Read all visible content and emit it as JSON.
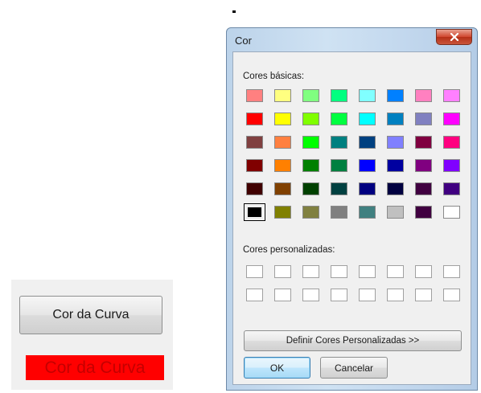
{
  "app": {
    "button_label": "Cor da Curva",
    "label_text": "Cor da Curva",
    "label_color": "#ff0000"
  },
  "dialog": {
    "title": "Cor",
    "close_icon": "close-icon",
    "basic_colors_label": "Cores básicas:",
    "basic_colors": [
      "#ff8080",
      "#ffff80",
      "#80ff80",
      "#00ff80",
      "#80ffff",
      "#0080ff",
      "#ff80c0",
      "#ff80ff",
      "#ff0000",
      "#ffff00",
      "#80ff00",
      "#00ff40",
      "#00ffff",
      "#0080c0",
      "#8080c0",
      "#ff00ff",
      "#804040",
      "#ff8040",
      "#00ff00",
      "#008080",
      "#004080",
      "#8080ff",
      "#800040",
      "#ff0080",
      "#800000",
      "#ff8000",
      "#008000",
      "#008040",
      "#0000ff",
      "#0000a0",
      "#800080",
      "#8000ff",
      "#400000",
      "#804000",
      "#004000",
      "#004040",
      "#000080",
      "#000040",
      "#400040",
      "#400080",
      "#000000",
      "#808000",
      "#808040",
      "#808080",
      "#408080",
      "#c0c0c0",
      "#400040",
      "#ffffff"
    ],
    "selected_index": 40,
    "custom_colors_label": "Cores personalizadas:",
    "custom_colors": [
      "#ffffff",
      "#ffffff",
      "#ffffff",
      "#ffffff",
      "#ffffff",
      "#ffffff",
      "#ffffff",
      "#ffffff",
      "#ffffff",
      "#ffffff",
      "#ffffff",
      "#ffffff",
      "#ffffff",
      "#ffffff",
      "#ffffff",
      "#ffffff"
    ],
    "define_custom_label": "Definir Cores Personalizadas >>",
    "ok_label": "OK",
    "cancel_label": "Cancelar"
  }
}
